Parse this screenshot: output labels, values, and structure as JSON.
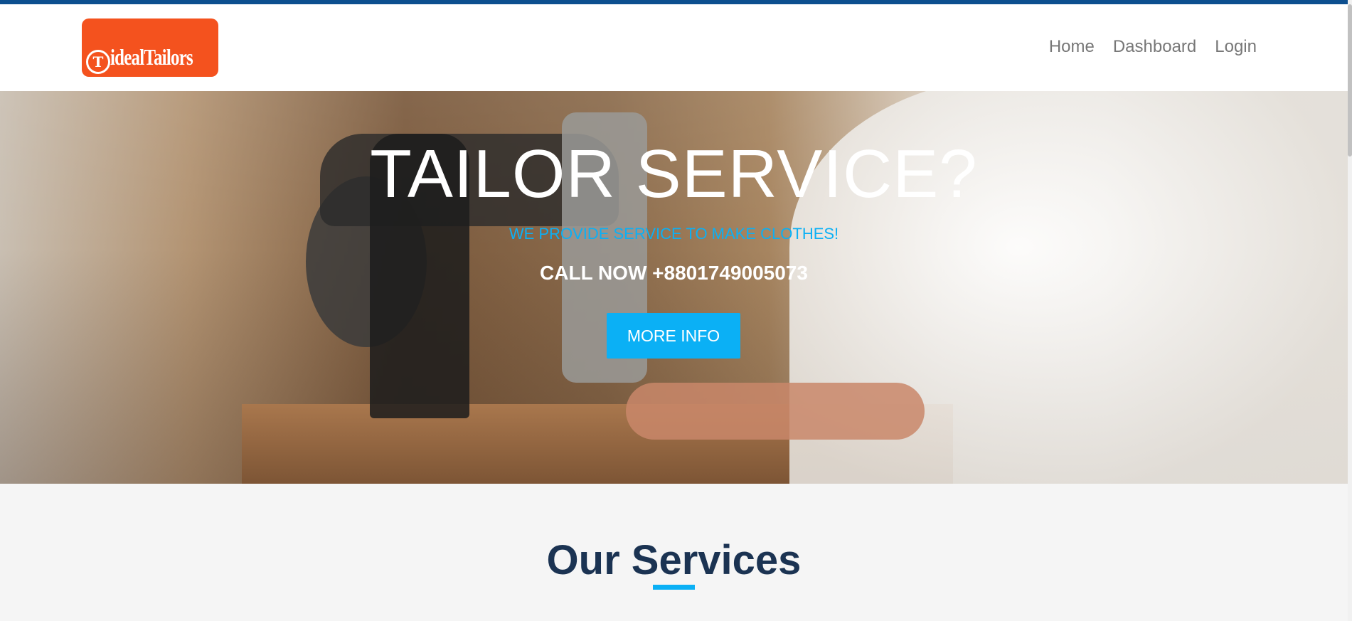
{
  "brand": {
    "logo_text": "idealTailors",
    "logo_mark": "T",
    "accent_color": "#f4521e"
  },
  "nav": {
    "items": [
      "Home",
      "Dashboard",
      "Login"
    ]
  },
  "hero": {
    "title": "TAILOR SERVICE?",
    "subtitle": "WE PROVIDE SERVICE TO MAKE CLOTHES!",
    "phone": "CALL NOW +8801749005073",
    "button_label": "MORE INFO",
    "accent_color": "#0bb0f5"
  },
  "services": {
    "title": "Our Services",
    "title_color": "#1b3352"
  }
}
